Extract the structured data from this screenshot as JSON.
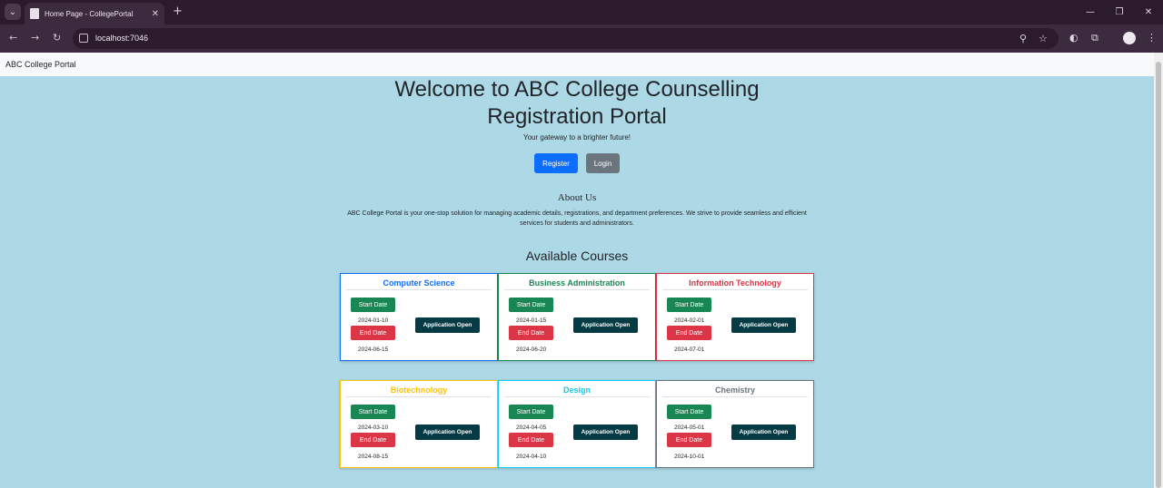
{
  "browser": {
    "tab_title": "Home Page - CollegePortal",
    "url": "localhost:7046"
  },
  "navbar": {
    "brand": "ABC College Portal"
  },
  "hero": {
    "title": "Welcome to ABC College Counselling Registration Portal",
    "tagline": "Your gateway to a brighter future!",
    "register_label": "Register",
    "login_label": "Login"
  },
  "about": {
    "title": "About Us",
    "text": "ABC College Portal is your one-stop solution for managing academic details, registrations, and department preferences. We strive to provide seamless and efficient services for students and administrators."
  },
  "courses": {
    "title": "Available Courses",
    "start_label": "Start Date",
    "end_label": "End Date",
    "status_label": "Application Open",
    "items": [
      {
        "name": "Computer Science",
        "start": "2024-01-10",
        "end": "2024-06-15",
        "color": "#0d6efd"
      },
      {
        "name": "Business Administration",
        "start": "2024-01-15",
        "end": "2024-06-20",
        "color": "#198754"
      },
      {
        "name": "Information Technology",
        "start": "2024-02-01",
        "end": "2024-07-01",
        "color": "#dc3545"
      },
      {
        "name": "Biotechnology",
        "start": "2024-03-10",
        "end": "2024-08-15",
        "color": "#ffc107"
      },
      {
        "name": "Design",
        "start": "2024-04-05",
        "end": "2024-04-10",
        "color": "#0dcaf0"
      },
      {
        "name": "Chemistry",
        "start": "2024-05-01",
        "end": "2024-10-01",
        "color": "#6c757d"
      }
    ]
  }
}
